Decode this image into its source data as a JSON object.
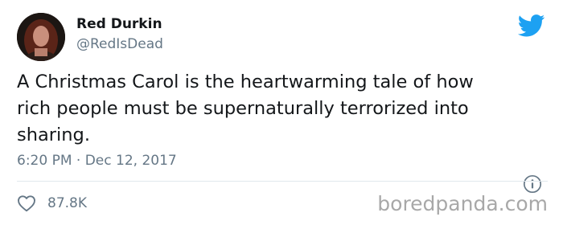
{
  "author": {
    "display_name": "Red Durkin",
    "handle": "@RedIsDead",
    "avatar_icon": "user-avatar"
  },
  "tweet": {
    "text_lines": [
      "A Christmas Carol is the heartwarming tale of how",
      "rich people must be supernaturally terrorized into",
      "sharing."
    ],
    "timestamp": "6:20 PM · Dec 12, 2017"
  },
  "actions": {
    "like_icon": "heart-icon",
    "like_count": "87.8K",
    "info_icon": "info-icon"
  },
  "brand": {
    "logo_icon": "twitter-bird-icon",
    "accent_color": "#1da1f2"
  },
  "watermark": {
    "text": "boredpanda.com"
  },
  "colors": {
    "primary_text": "#14171a",
    "secondary_text": "#657786",
    "divider": "#e1e8ed",
    "watermark": "#a8a8a8"
  }
}
